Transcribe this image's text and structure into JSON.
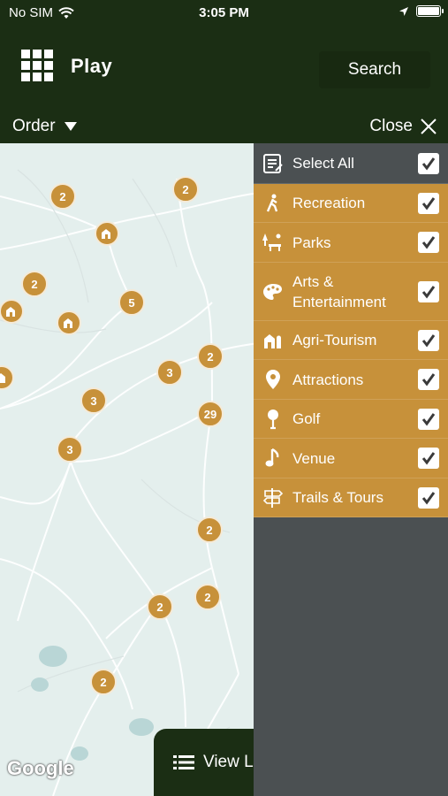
{
  "status_bar": {
    "carrier": "No SIM",
    "time": "3:05 PM"
  },
  "header": {
    "title": "Play",
    "search_label": "Search"
  },
  "subbar": {
    "order_label": "Order",
    "close_label": "Close"
  },
  "map": {
    "clusters": [
      "2",
      "2",
      "2",
      "5",
      "3",
      "2",
      "3",
      "29",
      "3",
      "2",
      "2",
      "2",
      "2"
    ],
    "attribution": "Google"
  },
  "view_list_label": "View L",
  "filter_panel": {
    "select_all": {
      "label": "Select All",
      "checked": true
    },
    "categories": [
      {
        "label": "Recreation",
        "icon": "hiker-icon",
        "checked": true
      },
      {
        "label": "Parks",
        "icon": "park-icon",
        "checked": true
      },
      {
        "label": "Arts & Entertainment",
        "icon": "palette-icon",
        "checked": true
      },
      {
        "label": "Agri-Tourism",
        "icon": "farm-icon",
        "checked": true
      },
      {
        "label": "Attractions",
        "icon": "map-pin-icon",
        "checked": true
      },
      {
        "label": "Golf",
        "icon": "golf-icon",
        "checked": true
      },
      {
        "label": "Venue",
        "icon": "music-note-icon",
        "checked": true
      },
      {
        "label": "Trails & Tours",
        "icon": "signpost-icon",
        "checked": true
      }
    ]
  },
  "colors": {
    "header_bg": "#1b2e14",
    "accent": "#c7913a",
    "panel_bg": "#4b5052"
  }
}
